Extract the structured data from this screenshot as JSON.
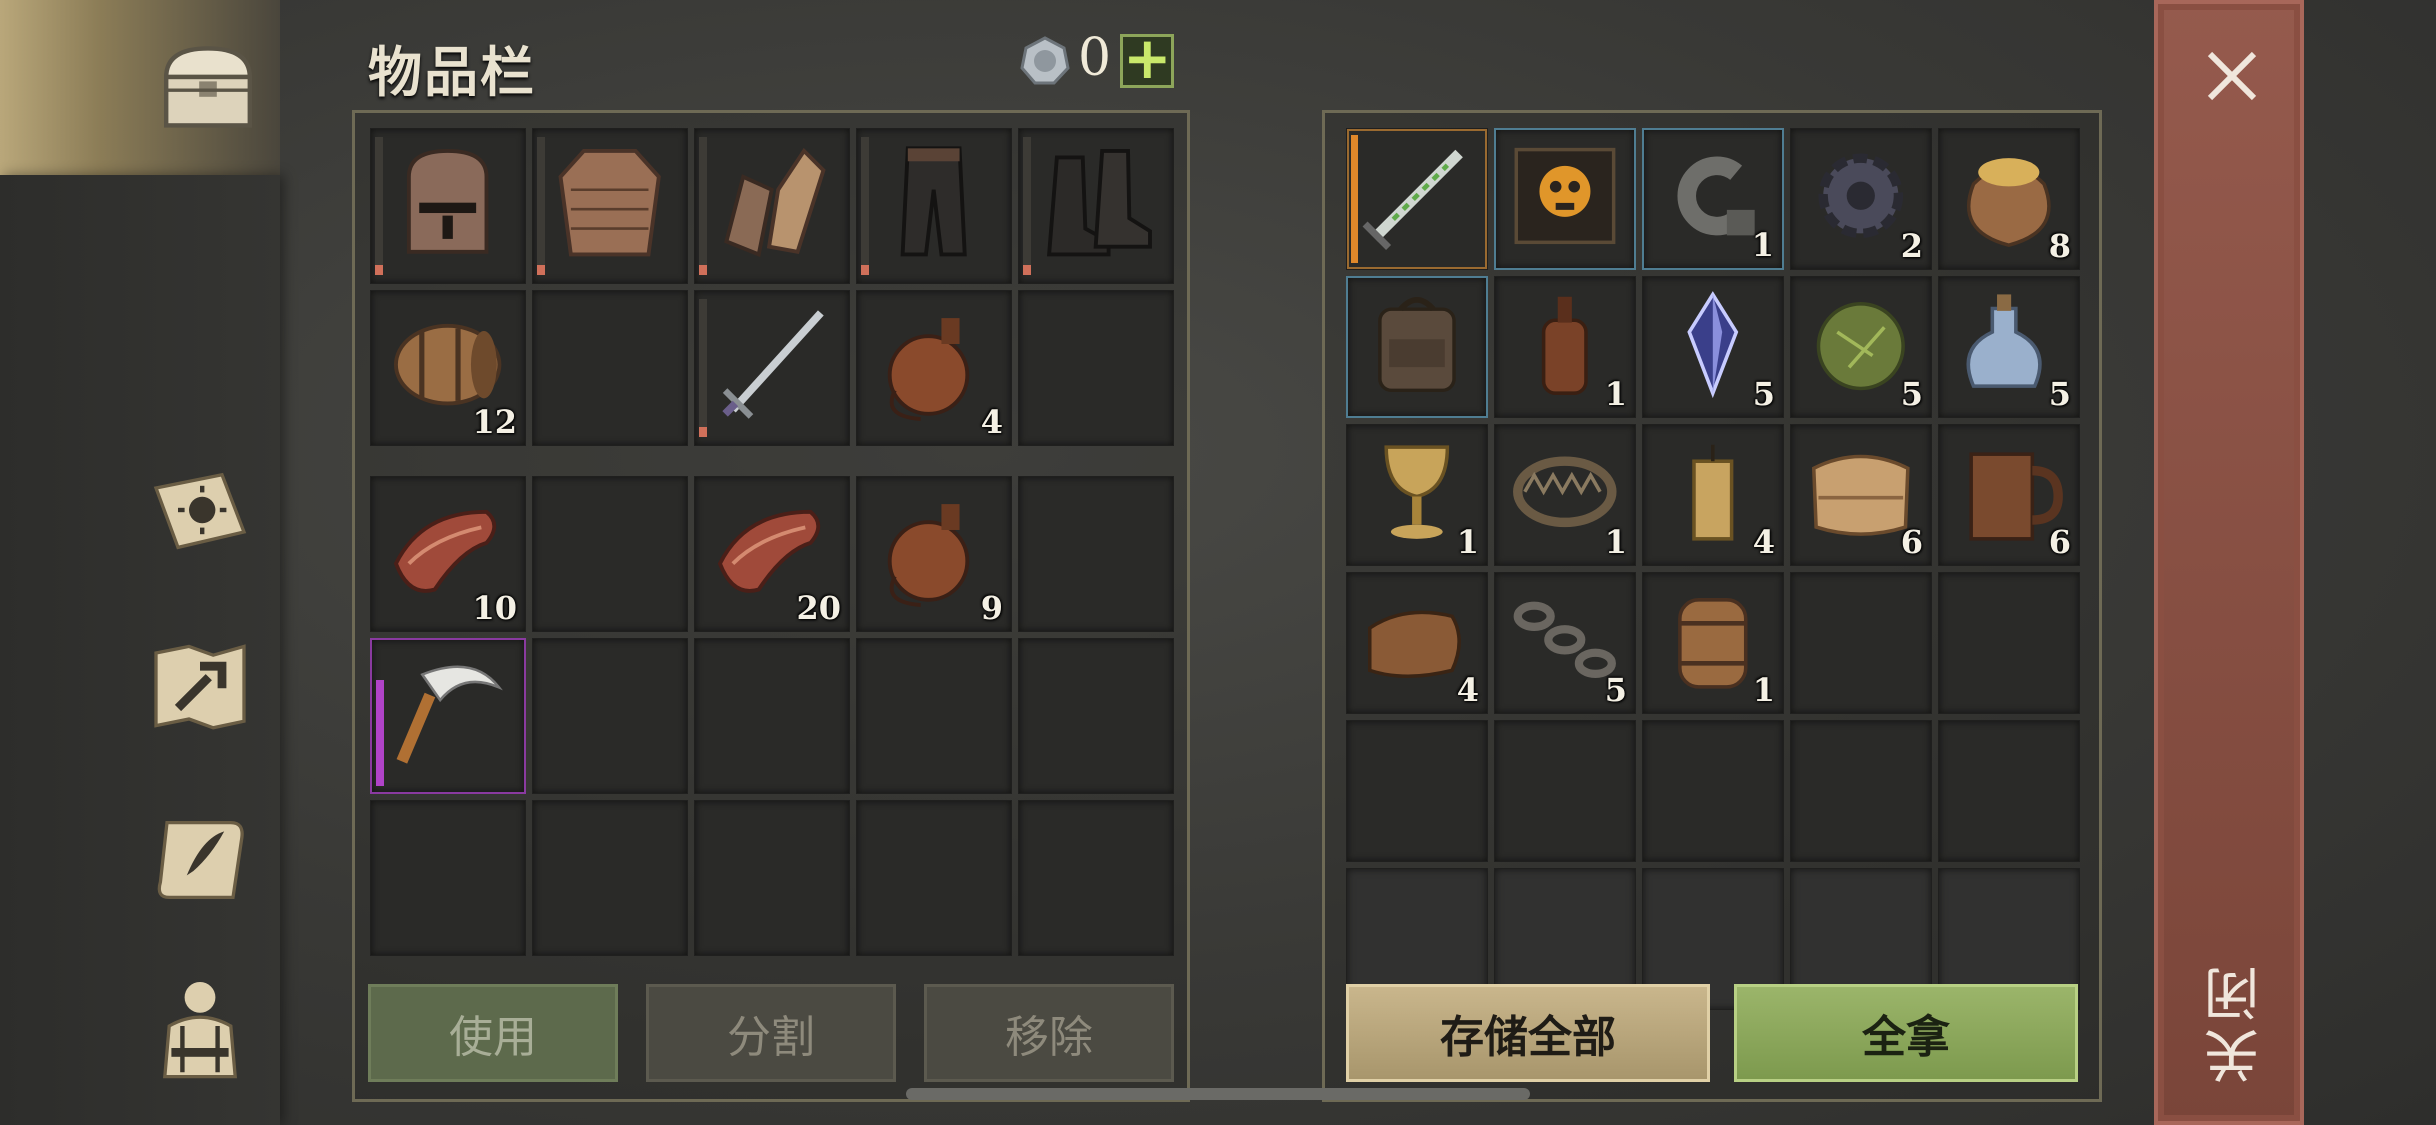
{
  "header": {
    "title": "物品栏",
    "currency_count": "0",
    "add_currency_label": "+"
  },
  "nav": {
    "items": [
      {
        "name": "chest-icon"
      },
      {
        "name": "skills-book-icon"
      },
      {
        "name": "crafting-map-icon"
      },
      {
        "name": "quest-scroll-icon"
      },
      {
        "name": "character-icon"
      }
    ]
  },
  "inventory": {
    "equipment": [
      {
        "icon": "helmet-icon",
        "count": ""
      },
      {
        "icon": "chainmail-icon",
        "count": ""
      },
      {
        "icon": "gloves-icon",
        "count": ""
      },
      {
        "icon": "pants-icon",
        "count": ""
      },
      {
        "icon": "boots-icon",
        "count": ""
      },
      {
        "icon": "barrel-icon",
        "count": "12"
      },
      {
        "icon": "",
        "count": ""
      },
      {
        "icon": "sword-icon",
        "count": ""
      },
      {
        "icon": "flask-icon",
        "count": "4"
      },
      {
        "icon": "",
        "count": ""
      }
    ],
    "bag": [
      {
        "icon": "meat-icon",
        "count": "10"
      },
      {
        "icon": "",
        "count": ""
      },
      {
        "icon": "meat-icon",
        "count": "20"
      },
      {
        "icon": "flask-icon",
        "count": "9"
      },
      {
        "icon": "",
        "count": ""
      },
      {
        "icon": "sickle-icon",
        "count": ""
      },
      {
        "icon": "",
        "count": ""
      },
      {
        "icon": "",
        "count": ""
      },
      {
        "icon": "",
        "count": ""
      },
      {
        "icon": "",
        "count": ""
      },
      {
        "icon": "",
        "count": ""
      },
      {
        "icon": "",
        "count": ""
      },
      {
        "icon": "",
        "count": ""
      },
      {
        "icon": "",
        "count": ""
      },
      {
        "icon": "",
        "count": ""
      }
    ],
    "buttons": {
      "use": "使用",
      "split": "分割",
      "remove": "移除"
    }
  },
  "storage": {
    "items": [
      {
        "icon": "poison-dagger-icon",
        "count": ""
      },
      {
        "icon": "skull-book-icon",
        "count": ""
      },
      {
        "icon": "hook-icon",
        "count": "1"
      },
      {
        "icon": "gear-icon",
        "count": "2"
      },
      {
        "icon": "grain-sack-icon",
        "count": "8"
      },
      {
        "icon": "backpack-icon",
        "count": ""
      },
      {
        "icon": "bottle-icon",
        "count": "1"
      },
      {
        "icon": "crystal-icon",
        "count": "5"
      },
      {
        "icon": "herb-ball-icon",
        "count": "5"
      },
      {
        "icon": "potion-icon",
        "count": "5"
      },
      {
        "icon": "goblet-icon",
        "count": "1"
      },
      {
        "icon": "bear-trap-icon",
        "count": "1"
      },
      {
        "icon": "candle-icon",
        "count": "4"
      },
      {
        "icon": "cloth-icon",
        "count": "6"
      },
      {
        "icon": "mug-icon",
        "count": "6"
      },
      {
        "icon": "leather-icon",
        "count": "4"
      },
      {
        "icon": "chain-icon",
        "count": "5"
      },
      {
        "icon": "keg-icon",
        "count": "1"
      },
      {
        "icon": "",
        "count": ""
      },
      {
        "icon": "",
        "count": ""
      },
      {
        "icon": "",
        "count": ""
      },
      {
        "icon": "",
        "count": ""
      },
      {
        "icon": "",
        "count": ""
      },
      {
        "icon": "",
        "count": ""
      },
      {
        "icon": "",
        "count": ""
      },
      {
        "icon": "",
        "count": ""
      },
      {
        "icon": "",
        "count": ""
      },
      {
        "icon": "",
        "count": ""
      },
      {
        "icon": "",
        "count": ""
      },
      {
        "icon": "",
        "count": ""
      }
    ],
    "buttons": {
      "store_all": "存储全部",
      "take_all": "全拿"
    }
  },
  "close": {
    "label": "关闭"
  },
  "colors": {
    "rarity_orange": "#e0882a",
    "rarity_blue": "#4f7d92",
    "rarity_purple": "#b043c8",
    "take_green": "#8da55a"
  }
}
